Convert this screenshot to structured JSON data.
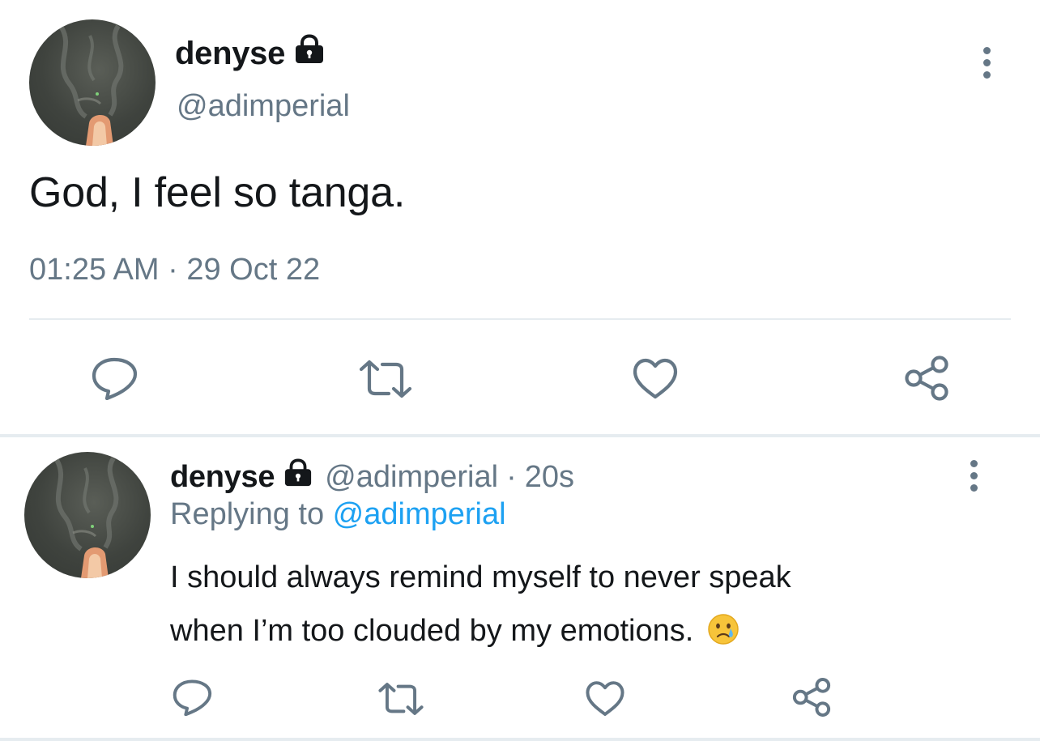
{
  "main_tweet": {
    "name": "denyse",
    "handle": "@adimperial",
    "text": "God, I feel so tanga.",
    "timestamp": "01:25 AM · 29 Oct 22",
    "icons": {
      "verified_lock": "lock-icon",
      "more": "more-vertical-icon",
      "reply": "reply-icon",
      "retweet": "retweet-icon",
      "like": "heart-icon",
      "share": "share-icon"
    }
  },
  "reply_tweet": {
    "name": "denyse",
    "handle": "@adimperial",
    "separator": "·",
    "time": "20s",
    "replying_prefix": "Replying to ",
    "replying_to": "@adimperial",
    "text_line1": "I should always remind myself to never speak",
    "text_line2": "when I’m too clouded by my emotions.",
    "emoji": "crying-face-emoji"
  },
  "colors": {
    "primary_text": "#14171a",
    "secondary_text": "#657786",
    "link": "#1da1f2",
    "divider": "#e6ecf0"
  }
}
